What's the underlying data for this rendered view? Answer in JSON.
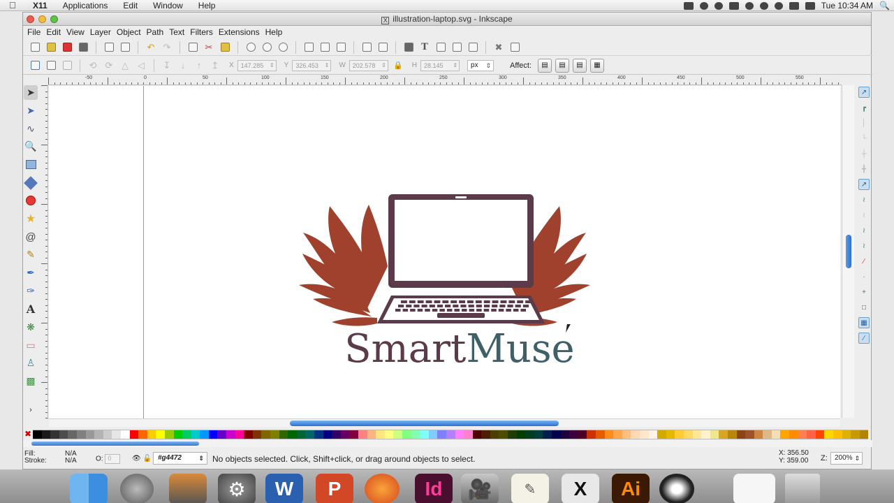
{
  "mac_menubar": {
    "app": "X11",
    "items": [
      "Applications",
      "Edit",
      "Window",
      "Help"
    ],
    "clock": "Tue 10:34 AM"
  },
  "window": {
    "title": "illustration-laptop.svg - Inkscape",
    "menu": [
      "File",
      "Edit",
      "View",
      "Layer",
      "Object",
      "Path",
      "Text",
      "Filters",
      "Extensions",
      "Help"
    ]
  },
  "controls": {
    "x_label": "X",
    "x_value": "147.285",
    "y_label": "Y",
    "y_value": "326.453",
    "w_label": "W",
    "w_value": "202.578",
    "h_label": "H",
    "h_value": "28.145",
    "unit": "px",
    "affect_label": "Affect:"
  },
  "ruler": {
    "labels": [
      "-50",
      "0",
      "50",
      "100",
      "150",
      "200",
      "250",
      "300",
      "350",
      "400",
      "450",
      "500",
      "550"
    ]
  },
  "canvas": {
    "logo_text": "SmartMuse",
    "colors": {
      "wing": "#a0412d",
      "laptop": "#5b3a49",
      "text_left": "#5b3a49",
      "text_right": "#3f6068"
    }
  },
  "status": {
    "fill_label": "Fill:",
    "stroke_label": "Stroke:",
    "fill_value": "N/A",
    "stroke_value": "N/A",
    "opacity_label": "O:",
    "opacity_value": "0",
    "layer": "#g4472",
    "message": "No objects selected. Click, Shift+click, or drag around objects to select.",
    "cursor_x": "X: 356.50",
    "cursor_y": "Y: 359.00",
    "zoom_label": "Z:",
    "zoom": "200%"
  },
  "palette": [
    "#000000",
    "#1a1a1a",
    "#333333",
    "#4d4d4d",
    "#666666",
    "#808080",
    "#999999",
    "#b3b3b3",
    "#cccccc",
    "#e6e6e6",
    "#ffffff",
    "#ff0000",
    "#ff6600",
    "#ffcc00",
    "#ffff00",
    "#99cc00",
    "#00cc00",
    "#00cc66",
    "#00cccc",
    "#0099ff",
    "#0000ff",
    "#6600cc",
    "#cc00cc",
    "#ff0099",
    "#800000",
    "#803300",
    "#806600",
    "#808000",
    "#336600",
    "#006600",
    "#006633",
    "#006666",
    "#003380",
    "#000080",
    "#330066",
    "#660066",
    "#800040",
    "#ff8080",
    "#ffb380",
    "#ffe680",
    "#ffff80",
    "#ccff80",
    "#80ff80",
    "#80ffb3",
    "#80ffff",
    "#80ccff",
    "#8080ff",
    "#b380ff",
    "#ff80ff",
    "#ff80cc",
    "#4d0000",
    "#4d1f00",
    "#4d3d00",
    "#4d4d00",
    "#1f3d00",
    "#003d00",
    "#003d1f",
    "#003d3d",
    "#001f4d",
    "#00004d",
    "#1f003d",
    "#3d003d",
    "#4d0026",
    "#cc3300",
    "#e65c00",
    "#ff8c1a",
    "#ffa64d",
    "#ffbf80",
    "#ffd9b3",
    "#ffe6cc",
    "#fff2e6",
    "#d4aa00",
    "#e6b800",
    "#ffcc33",
    "#ffd966",
    "#ffe699",
    "#fff2cc",
    "#f0e68c",
    "#daa520",
    "#b8860b",
    "#8b4513",
    "#a0522d",
    "#cd853f",
    "#deb887",
    "#f5deb3",
    "#ffa500",
    "#ff8c00",
    "#ff7f50",
    "#ff6347",
    "#ff4500",
    "#ffd700",
    "#ffbf00",
    "#e0b000",
    "#c89a00",
    "#b08600"
  ],
  "dock": [
    "finder",
    "launchpad",
    "photos",
    "system-prefs",
    "word",
    "powerpoint",
    "firefox",
    "indesign",
    "imovie",
    "textedit",
    "x11",
    "illustrator",
    "inkscape",
    "preview",
    "trash"
  ]
}
